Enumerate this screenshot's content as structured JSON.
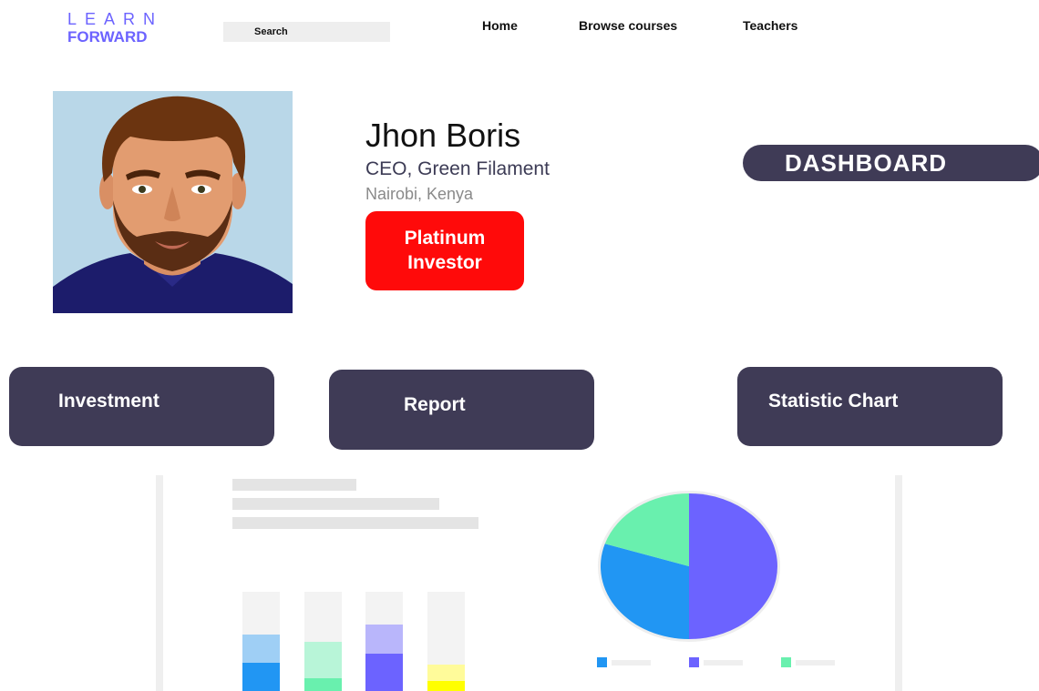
{
  "header": {
    "logo_line1": "LEARN",
    "logo_line2": "FORWARD",
    "search_placeholder": "Search",
    "nav": [
      "Home",
      "Browse courses",
      "Teachers"
    ]
  },
  "profile": {
    "name": "Jhon Boris",
    "title": "CEO, Green Filament",
    "location": "Nairobi, Kenya",
    "badge": "Platinum Investor"
  },
  "dashboard_label": "DASHBOARD",
  "cards": [
    "Investment",
    "Report",
    "Statistic Chart"
  ],
  "colors": {
    "brand": "#6c63ff",
    "card_bg": "#3f3b56",
    "badge_bg": "#ff0a0a",
    "blue": "#2196f3",
    "purple": "#6c63ff",
    "green": "#69f0ae",
    "yellow": "#ffff00"
  },
  "illustration": {
    "bars": [
      {
        "color": "#2196f3",
        "light": "#9fcff5",
        "dark_fraction": 0.28,
        "light_fraction": 0.29
      },
      {
        "color": "#69f0ae",
        "light": "#b8f5d8",
        "dark_fraction": 0.13,
        "light_fraction": 0.37
      },
      {
        "color": "#6c63ff",
        "light": "#b9b6fb",
        "dark_fraction": 0.38,
        "light_fraction": 0.29
      },
      {
        "color": "#ffff00",
        "light": "#fffb9a",
        "dark_fraction": 0.1,
        "light_fraction": 0.17
      }
    ],
    "pie": [
      {
        "color": "#6c63ff",
        "fraction": 0.5
      },
      {
        "color": "#2196f3",
        "fraction": 0.3
      },
      {
        "color": "#69f0ae",
        "fraction": 0.2
      }
    ],
    "legend_colors": [
      "#2196f3",
      "#6c63ff",
      "#69f0ae"
    ]
  }
}
